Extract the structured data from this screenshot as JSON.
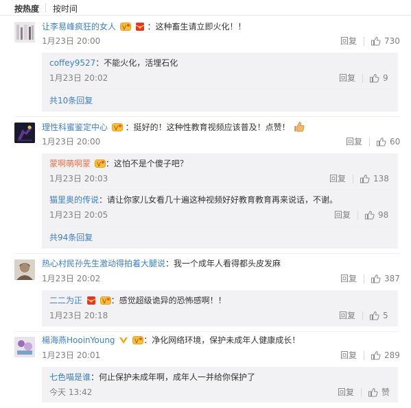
{
  "sort_tabs": [
    "按热度",
    "按时间"
  ],
  "reply_label": "回复",
  "comments": [
    {
      "user": "让李易峰疯狂的女人",
      "text": "：这种畜生请立即火化！！",
      "time": "1月23日 20:00",
      "likes": "730",
      "replies": [
        {
          "user": "coffey9527",
          "text": "：不能火化，活埋石化",
          "time": "1月23日 20:02",
          "likes": "9"
        }
      ],
      "more_label": "共10条回复"
    },
    {
      "user": "理性科蜜鉴定中心",
      "text": "：挺好的！这种性教育视频应该普及！点赞！",
      "time": "1月23日 20:00",
      "likes": "60",
      "replies": [
        {
          "user": "蒙啊萌啊蒙",
          "text": "：这怕不是个傻子吧？",
          "time": "1月23日 20:03",
          "likes": "138"
        },
        {
          "user": "猫里奥的传说",
          "text": "：请让你家儿女看几十遍这种视频好好教育教育再来说话，不谢。",
          "time": "1月23日 20:05",
          "likes": "98"
        }
      ],
      "more_label": "共94条回复"
    },
    {
      "user": "热心村民孙先生激动得拍着大腿说",
      "text": "：我一个成年人看得都头皮发麻",
      "time": "1月23日 20:02",
      "likes": "387",
      "replies": [
        {
          "user": "二二为正",
          "text": "：感觉超级诡异的恐怖感啊！！",
          "time": "1月23日 20:18",
          "likes": "5"
        }
      ]
    },
    {
      "user": "楊海燕HooinYoung",
      "text": "：净化网络环境，保护未成年人健康成长！",
      "time": "1月23日 20:01",
      "likes": "289",
      "replies": [
        {
          "user": "七色喵是谁",
          "text": "：何止保护未成年啊，成年人一并给你保护了",
          "time": "今天 13:42",
          "likes": "赞"
        }
      ]
    }
  ],
  "colors": {
    "username": "#eb7350",
    "link": "#3f7fc1",
    "meta": "#808080",
    "reply_bg": "#f2f2f5"
  },
  "icons": [
    "thumb-up-icon",
    "vip-badge-icon",
    "red-envelope-icon",
    "crown-badge-icon",
    "thumbs-up-emoji-icon"
  ]
}
